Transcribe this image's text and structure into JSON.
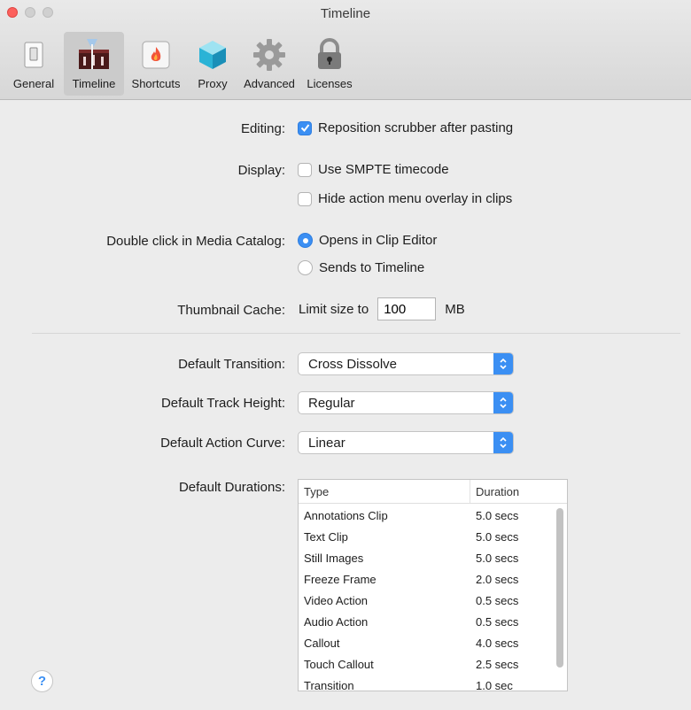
{
  "window": {
    "title": "Timeline"
  },
  "toolbar": {
    "items": [
      {
        "label": "General",
        "icon": "general-switch-icon"
      },
      {
        "label": "Timeline",
        "icon": "timeline-icon",
        "selected": true
      },
      {
        "label": "Shortcuts",
        "icon": "shortcuts-fire-icon"
      },
      {
        "label": "Proxy",
        "icon": "proxy-cube-icon"
      },
      {
        "label": "Advanced",
        "icon": "gear-icon"
      },
      {
        "label": "Licenses",
        "icon": "lock-icon"
      }
    ]
  },
  "editing": {
    "label": "Editing:",
    "option": "Reposition scrubber after pasting",
    "checked": true
  },
  "display": {
    "label": "Display:",
    "options": [
      {
        "label": "Use SMPTE timecode",
        "checked": false
      },
      {
        "label": "Hide action menu overlay in clips",
        "checked": false
      }
    ]
  },
  "double_click": {
    "label": "Double click in Media Catalog:",
    "options": [
      {
        "label": "Opens in Clip Editor",
        "selected": true
      },
      {
        "label": "Sends to Timeline",
        "selected": false
      }
    ]
  },
  "thumbnail_cache": {
    "label": "Thumbnail Cache:",
    "prefix": "Limit size to",
    "value": "100",
    "unit": "MB"
  },
  "default_transition": {
    "label": "Default Transition:",
    "value": "Cross Dissolve"
  },
  "default_track_height": {
    "label": "Default Track Height:",
    "value": "Regular"
  },
  "default_action_curve": {
    "label": "Default Action Curve:",
    "value": "Linear"
  },
  "default_durations": {
    "label": "Default Durations:",
    "columns": [
      "Type",
      "Duration"
    ],
    "rows": [
      [
        "Annotations Clip",
        "5.0 secs"
      ],
      [
        "Text Clip",
        "5.0 secs"
      ],
      [
        "Still Images",
        "5.0 secs"
      ],
      [
        "Freeze Frame",
        "2.0 secs"
      ],
      [
        "Video Action",
        "0.5 secs"
      ],
      [
        "Audio Action",
        "0.5 secs"
      ],
      [
        "Callout",
        "4.0 secs"
      ],
      [
        "Touch Callout",
        "2.5 secs"
      ],
      [
        "Transition",
        "1.0 sec"
      ]
    ]
  },
  "help": {
    "glyph": "?"
  },
  "colors": {
    "accent": "#3b8ff3",
    "close": "#fc605c"
  }
}
